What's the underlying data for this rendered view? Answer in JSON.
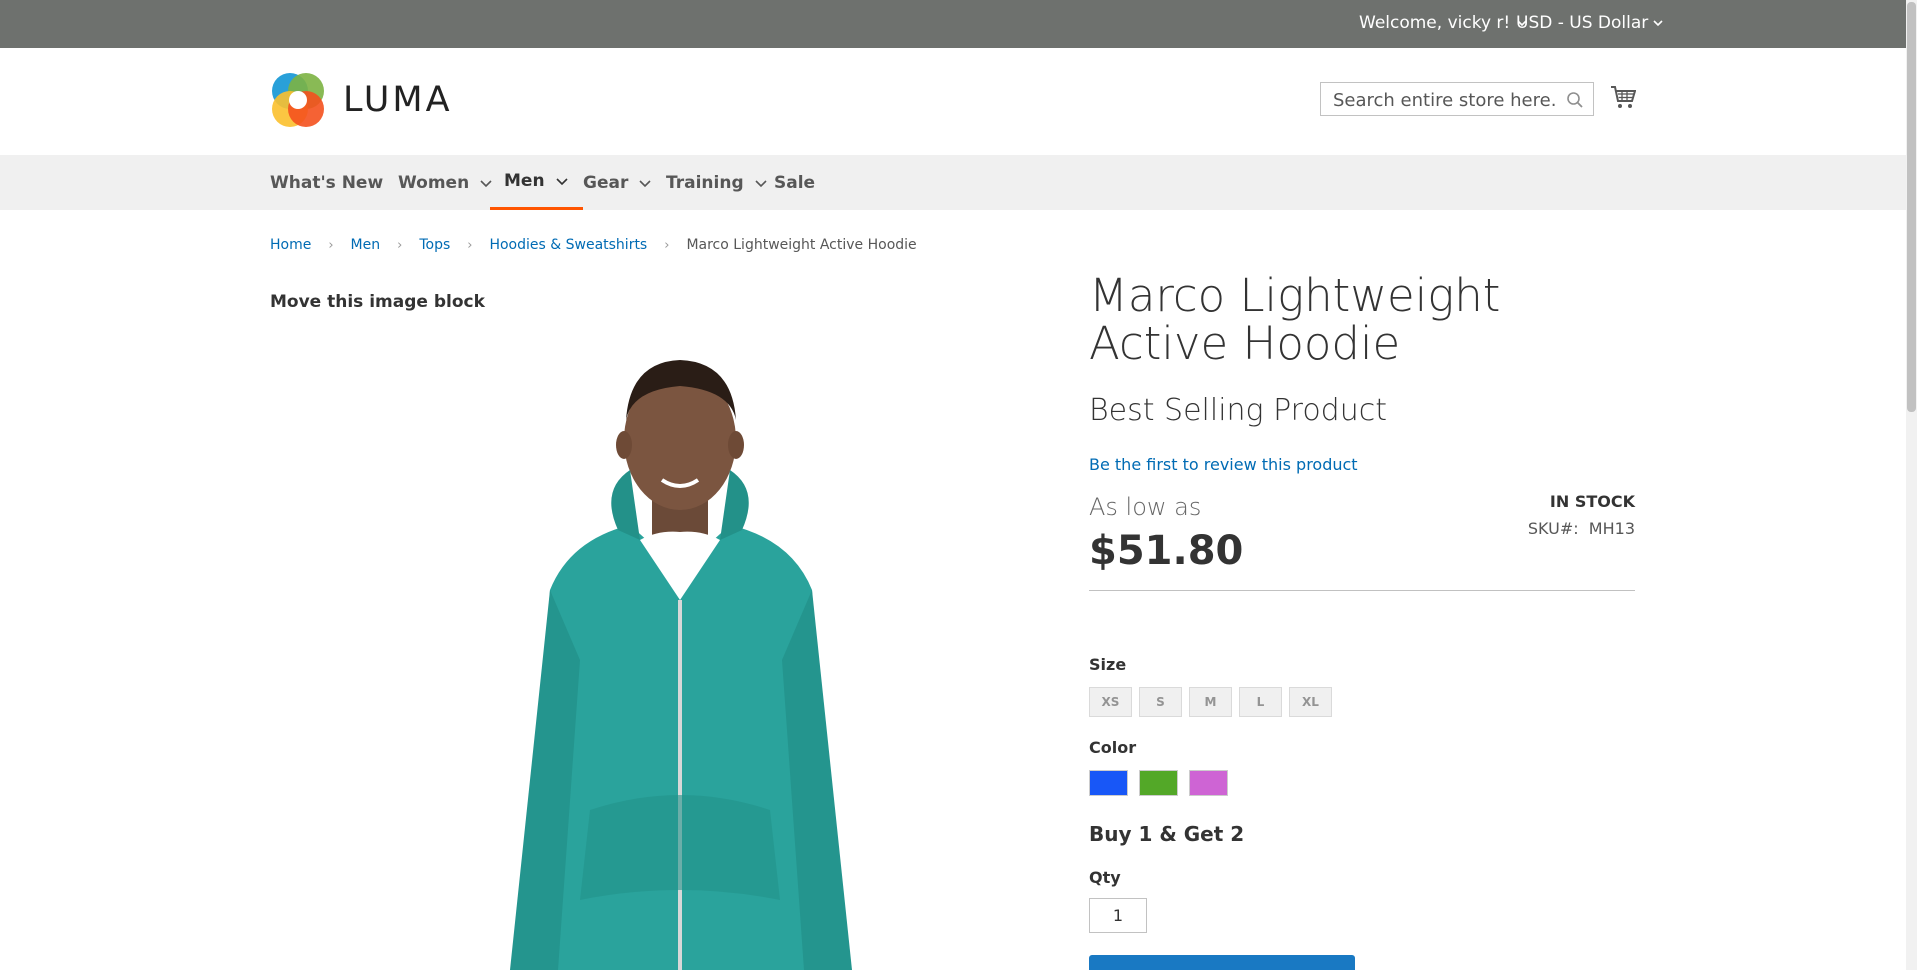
{
  "topbar": {
    "welcome": "Welcome, vicky r!",
    "currency": "USD - US Dollar"
  },
  "header": {
    "logo_text": "LUMA",
    "search_placeholder": "Search entire store here...",
    "icons": [
      "search-icon",
      "cart-icon"
    ]
  },
  "nav": {
    "items": [
      {
        "label": "What's New",
        "has_dropdown": false
      },
      {
        "label": "Women",
        "has_dropdown": true
      },
      {
        "label": "Men",
        "has_dropdown": true,
        "active": true
      },
      {
        "label": "Gear",
        "has_dropdown": true
      },
      {
        "label": "Training",
        "has_dropdown": true
      },
      {
        "label": "Sale",
        "has_dropdown": false
      }
    ]
  },
  "breadcrumb": {
    "items": [
      "Home",
      "Men",
      "Tops",
      "Hoodies & Sweatshirts"
    ],
    "current": "Marco Lightweight Active Hoodie"
  },
  "gallery": {
    "move_label": "Move this image block"
  },
  "product": {
    "title": "Marco Lightweight Active Hoodie",
    "subtitle": "Best Selling Product",
    "review_link": "Be the first to review this product",
    "price_prefix": "As low as",
    "price": "$51.80",
    "stock": "IN STOCK",
    "sku_label": "SKU#:",
    "sku": "MH13",
    "size_label": "Size",
    "sizes": [
      "XS",
      "S",
      "M",
      "L",
      "XL"
    ],
    "color_label": "Color",
    "colors": [
      {
        "name": "Blue",
        "hex": "#1857f7"
      },
      {
        "name": "Green",
        "hex": "#53a828"
      },
      {
        "name": "Lavender",
        "hex": "#ce64d4"
      }
    ],
    "promo": "Buy 1 & Get 2",
    "qty_label": "Qty",
    "qty_value": "1"
  },
  "colors": {
    "topbar_bg": "#6e716e",
    "nav_bg": "#f0f0f0",
    "link": "#006bb4",
    "accent": "#ff5501",
    "primary_button": "#1979c3"
  }
}
